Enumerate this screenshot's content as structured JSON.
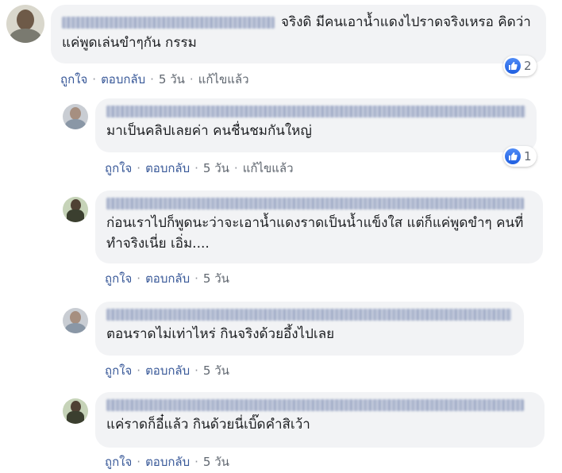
{
  "comments": [
    {
      "text": "จริงดิ มีคนเอาน้ำแดงไปราดจริงเหรอ คิดว่าแค่พูดเล่นขำๆกัน กรรม",
      "like": "ถูกใจ",
      "reply": "ตอบกลับ",
      "time": "5 วัน",
      "edited": "แก้ไขแล้ว",
      "reactions": "2"
    },
    {
      "text": "มาเป็นคลิปเลยค่า คนชื่นชมกันใหญ่",
      "like": "ถูกใจ",
      "reply": "ตอบกลับ",
      "time": "5 วัน",
      "edited": "แก้ไขแล้ว",
      "reactions": "1"
    },
    {
      "text": "ก่อนเราไปก็พูดนะว่าจะเอาน้ำแดงราดเป็นน้ำแข็งใส แต่ก็แค่พูดขำๆ คนที่ทำจริงเนี่ย เอิ่ม....",
      "like": "ถูกใจ",
      "reply": "ตอบกลับ",
      "time": "5 วัน"
    },
    {
      "text": "ตอนราดไม่เท่าไหร่ กินจริงด้วยอึ้งไปเลย",
      "like": "ถูกใจ",
      "reply": "ตอบกลับ",
      "time": "5 วัน"
    },
    {
      "text": "แค่ราดก็อี๋แล้ว กินด้วยนี่เบิ๊ดคำสิเว้า",
      "like": "ถูกใจ",
      "reply": "ตอบกลับ",
      "time": "5 วัน"
    }
  ]
}
